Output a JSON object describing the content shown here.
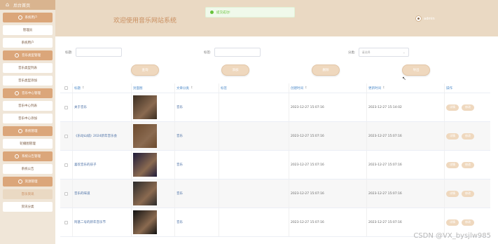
{
  "sidebar": {
    "brand": "后台首页",
    "groups": [
      {
        "title": "系统用户",
        "items": [
          {
            "label": "管理员"
          },
          {
            "label": "系统用户"
          }
        ]
      },
      {
        "title": "音乐类型管理",
        "items": [
          {
            "label": "音乐类型列表"
          },
          {
            "label": "音乐类型添加"
          }
        ]
      },
      {
        "title": "音乐中心管理",
        "items": [
          {
            "label": "音乐中心列表"
          },
          {
            "label": "音乐中心添加"
          }
        ]
      },
      {
        "title": "系统管理",
        "items": [
          {
            "label": "轮播图管理"
          }
        ]
      },
      {
        "title": "系统公告管理",
        "items": [
          {
            "label": "系统公告"
          }
        ]
      },
      {
        "title": "资源管理",
        "items": [
          {
            "label": "音乐资讯",
            "active": true
          },
          {
            "label": "资讯分类"
          }
        ]
      }
    ]
  },
  "header": {
    "title": "欢迎使用音乐网站系统",
    "toast": "提交成功!",
    "username": "admin"
  },
  "search": {
    "title_label": "标题:",
    "title_placeholder": "",
    "tag_label": "标签:",
    "tag_placeholder": "",
    "category_label": "分类:",
    "category_placeholder": "请选择"
  },
  "buttons": {
    "query": "查询",
    "add": "添加",
    "delete": "删除",
    "export": "导出"
  },
  "table": {
    "headers": {
      "title": "标题",
      "image": "封面图",
      "category": "文章分类",
      "tag": "标签",
      "created": "创建时间",
      "updated": "更新时间",
      "ops": "操作"
    },
    "rows": [
      {
        "title": "关于音乐",
        "category": "音乐",
        "tag": "",
        "created": "2023-12-27 15:07:16",
        "updated": "2023-12-27 15:14:02",
        "thumb": "#3b2e22"
      },
      {
        "title": "《乐动山城》2024新年音乐会",
        "category": "音乐",
        "tag": "",
        "created": "2023-12-27 15:07:16",
        "updated": "2023-12-27 15:07:16",
        "thumb": "#6b4a2e"
      },
      {
        "title": "喜欢音乐的孩子",
        "category": "音乐",
        "tag": "",
        "created": "2023-12-27 15:07:16",
        "updated": "2023-12-27 15:07:16",
        "thumb": "#1e1b3a"
      },
      {
        "title": "音乐的味道",
        "category": "音乐",
        "tag": "",
        "created": "2023-12-27 15:07:16",
        "updated": "2023-12-27 15:07:16",
        "thumb": "#2a2a2a"
      },
      {
        "title": "阿基二号的新年音乐节",
        "category": "音乐",
        "tag": "",
        "created": "2023-12-27 15:07:16",
        "updated": "2023-12-27 15:07:16",
        "thumb": "#111111"
      }
    ],
    "row_actions": {
      "detail": "详情",
      "edit": "修改"
    }
  },
  "watermark": "CSDN @VX_bysjlw985",
  "colors": {
    "accent": "#dba67a",
    "header_bg": "#ead9c3",
    "sidebar_bg": "#f0e6d8"
  }
}
